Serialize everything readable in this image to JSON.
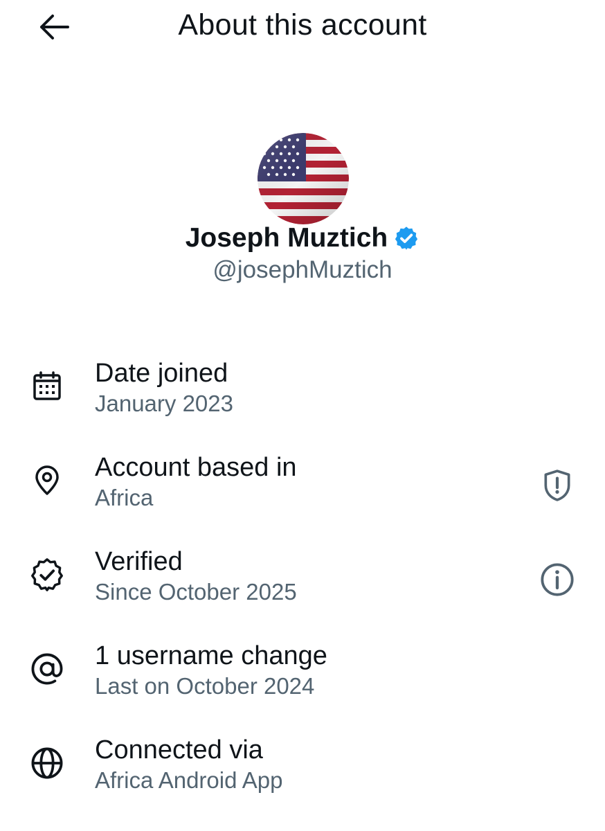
{
  "header": {
    "title": "About this account",
    "back_icon": "arrow-left-icon"
  },
  "profile": {
    "name": "Joseph Muztich",
    "handle": "@josephMuztich",
    "verified_icon": "verified-badge-icon",
    "avatar": "us-flag-avatar"
  },
  "rows": [
    {
      "icon": "calendar-icon",
      "label": "Date joined",
      "value": "January 2023"
    },
    {
      "icon": "location-pin-icon",
      "label": "Account based in",
      "value": "Africa",
      "action_icon": "shield-alert-icon"
    },
    {
      "icon": "verified-check-icon",
      "label": "Verified",
      "value": "Since October 2025",
      "action_icon": "info-icon"
    },
    {
      "icon": "at-sign-icon",
      "label": "1 username change",
      "value": "Last on October 2024"
    },
    {
      "icon": "globe-icon",
      "label": "Connected via",
      "value": "Africa Android App"
    }
  ],
  "colors": {
    "text_primary": "#0f1419",
    "text_secondary": "#536471",
    "verified_blue": "#1d9bf0",
    "flag_red": "#b22234",
    "flag_blue": "#3c3b6e"
  }
}
